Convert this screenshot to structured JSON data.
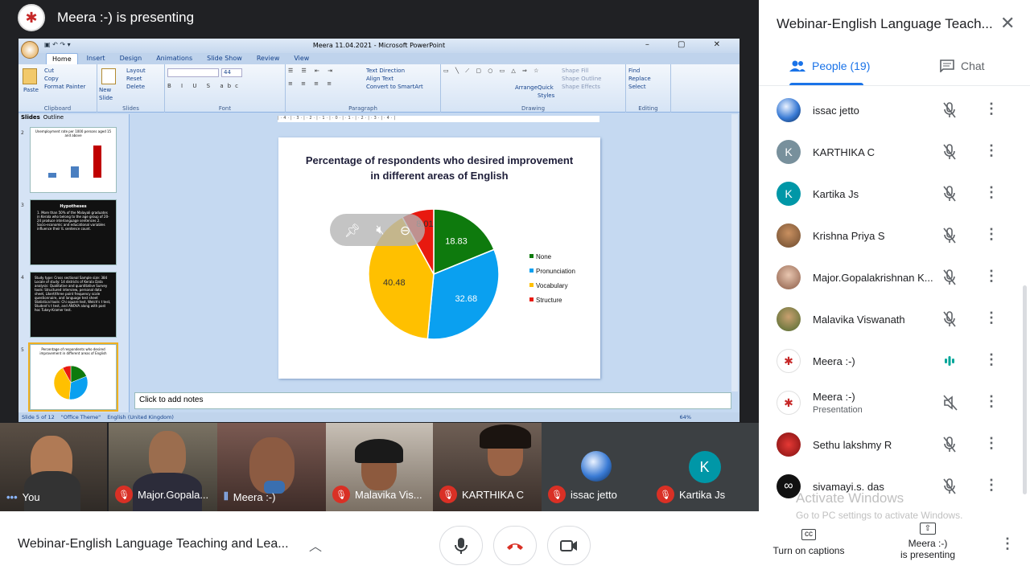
{
  "header": {
    "presenting_text": "Meera :-) is presenting"
  },
  "ppt": {
    "window_title": "Meera 11.04.2021 - Microsoft PowerPoint",
    "tabs": [
      "Home",
      "Insert",
      "Design",
      "Animations",
      "Slide Show",
      "Review",
      "View"
    ],
    "groups": {
      "clipboard": {
        "label": "Clipboard",
        "paste": "Paste",
        "cut": "Cut",
        "copy": "Copy",
        "format_painter": "Format Painter"
      },
      "slides": {
        "label": "Slides",
        "new_slide": "New Slide",
        "layout": "Layout",
        "reset": "Reset",
        "delete": "Delete"
      },
      "font": {
        "label": "Font",
        "size": "44"
      },
      "paragraph": {
        "label": "Paragraph",
        "text_direction": "Text Direction",
        "align_text": "Align Text",
        "smartart": "Convert to SmartArt"
      },
      "drawing": {
        "label": "Drawing",
        "arrange": "Arrange",
        "quick_styles": "Quick Styles",
        "shape_fill": "Shape Fill",
        "shape_outline": "Shape Outline",
        "shape_effects": "Shape Effects"
      },
      "editing": {
        "label": "Editing",
        "find": "Find",
        "replace": "Replace",
        "select": "Select"
      }
    },
    "panel_tabs": [
      "Slides",
      "Outline"
    ],
    "thumbs": [
      {
        "num": "2",
        "text": "Unemployment rate per 1000 persons aged 15 and above"
      },
      {
        "num": "3",
        "title": "Hypotheses",
        "text": "1. More than 50% of the Malayali graduates in Kerala who belong to the age group of 20-24 produce interlanguage sentences 2. Socio-economic and educational variables influence their IL sentence count."
      },
      {
        "num": "4",
        "text": "Study type: Cross sectional Sample size: 384 Locale of study: 14 districts of Kerala Data analysis: Qualitative and quantitative Survey tools: Structured interview, personal data sheet, Likert/three point frequency scale questionnaire, and language test sheet Statistical tools: Chi square test, Welch's t test, Student's t test, and ANOVA along with post hoc Tukey-Kramer test."
      },
      {
        "num": "5",
        "text": "Percentage of respondents who desired improvement in different areas of English"
      }
    ],
    "notes_placeholder": "Click to add notes",
    "status": {
      "slide": "Slide 5 of 12",
      "theme": "\"Office Theme\"",
      "language": "English (United Kingdom)",
      "zoom": "64%"
    }
  },
  "chart_data": {
    "type": "pie",
    "title": "Percentage of respondents who desired improvement in different areas of English",
    "categories": [
      "None",
      "Pronunciation",
      "Vocabulary",
      "Structure"
    ],
    "values": [
      18.83,
      32.68,
      40.48,
      8.01
    ],
    "colors": [
      "#0e7a0d",
      "#0aa0f0",
      "#ffc000",
      "#e8190f"
    ],
    "legend": "right"
  },
  "tiles": [
    {
      "name": "You",
      "indicator": "dots"
    },
    {
      "name": "Major.Gopala...",
      "indicator": "mic-off"
    },
    {
      "name": "Meera :-)",
      "indicator": "speaking"
    },
    {
      "name": "Malavika Vis...",
      "indicator": "mic-off"
    },
    {
      "name": "KARTHIKA C",
      "indicator": "mic-off"
    },
    {
      "name": "issac jetto",
      "indicator": "mic-off"
    },
    {
      "name": "Kartika Js",
      "indicator": "mic-off",
      "avatar": "K"
    }
  ],
  "bottom": {
    "meeting_name": "Webinar-English Language Teaching and Lea...",
    "captions_label": "Turn on captions",
    "presenting_label_1": "Meera :-)",
    "presenting_label_2": "is presenting"
  },
  "panel": {
    "title": "Webinar-English Language Teach...",
    "people_tab": "People (19)",
    "chat_tab": "Chat",
    "people": [
      {
        "name": "issac jetto",
        "mic": "off"
      },
      {
        "name": "KARTHIKA C",
        "mic": "off",
        "initial": "K",
        "color": "#78909c"
      },
      {
        "name": "Kartika Js",
        "mic": "off",
        "initial": "K",
        "color": "#0097a7"
      },
      {
        "name": "Krishna Priya S",
        "mic": "off"
      },
      {
        "name": "Major.Gopalakrishnan K...",
        "mic": "off"
      },
      {
        "name": "Malavika Viswanath",
        "mic": "off"
      },
      {
        "name": "Meera :-)",
        "mic": "speaking"
      },
      {
        "name": "Meera :-)",
        "sub": "Presentation",
        "mic": "muted-audio"
      },
      {
        "name": "Sethu lakshmy R",
        "mic": "off"
      },
      {
        "name": "sivamayi.s. das",
        "mic": "off"
      }
    ]
  },
  "watermark": {
    "line1": "Activate Windows",
    "line2": "Go to PC settings to activate Windows."
  }
}
